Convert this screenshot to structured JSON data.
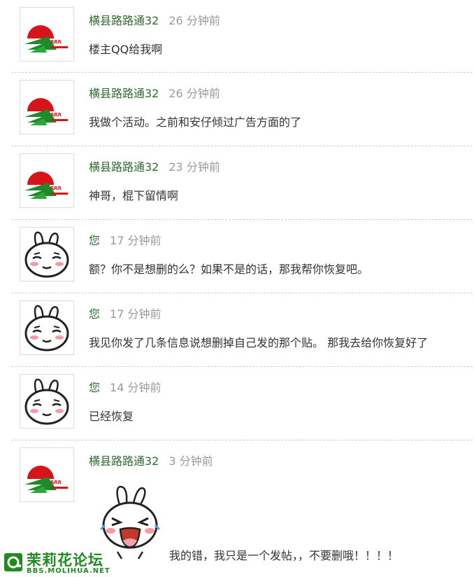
{
  "messages": [
    {
      "user": "横县路路通32",
      "time": "26 分钟前",
      "text": "楼主QQ给我啊",
      "avatar": "horizon-logo"
    },
    {
      "user": "横县路路通32",
      "time": "26 分钟前",
      "text": "我做个活动。之前和安仔倾过广告方面的了",
      "avatar": "horizon-logo"
    },
    {
      "user": "横县路路通32",
      "time": "23 分钟前",
      "text": "神哥，棍下留情啊",
      "avatar": "horizon-logo"
    },
    {
      "user": "您",
      "time": "17 分钟前",
      "text": "额？你不是想删的么？如果不是的话，那我帮你恢复吧。",
      "avatar": "bunny"
    },
    {
      "user": "您",
      "time": "17 分钟前",
      "text": "我见你发了几条信息说想删掉自己发的那个贴。  那我去给你恢复好了",
      "avatar": "bunny"
    },
    {
      "user": "您",
      "time": "14 分钟前",
      "text": "已经恢复",
      "avatar": "bunny"
    },
    {
      "user": "横县路路通32",
      "time": "3 分钟前",
      "text": "我的错，我只是一个发帖，，不要删哦！！！！",
      "avatar": "horizon-logo"
    }
  ],
  "watermark": {
    "title": "茉莉花论坛",
    "url": "BBS.MOLIHUA.NET"
  },
  "colors": {
    "username": "#2f6b2f",
    "time": "#999999",
    "separator": "#cfcfcf",
    "watermark": "#1f8a1f"
  }
}
